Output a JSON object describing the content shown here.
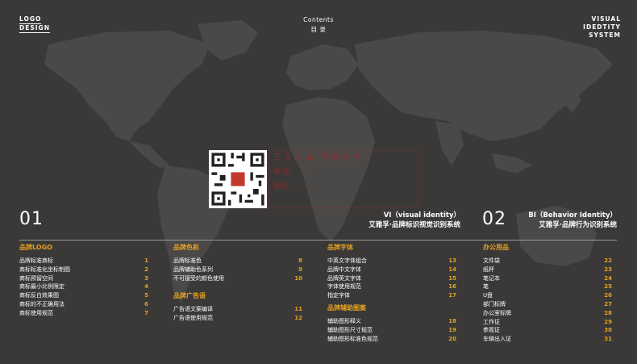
{
  "header": {
    "left_line1": "LOGO",
    "left_line2": "DESIGN",
    "center_en": "Contents",
    "center_cn": "目 录",
    "right_line1": "VISUAL",
    "right_line2": "IDEDTITY",
    "right_line3": "SYSTEM"
  },
  "watermark": {
    "line1": "三 艾 众 品 · 牌 原 商 务 ...",
    "line2": "电话：...",
    "line3": "网址：..."
  },
  "section_vi": {
    "number": "01",
    "title_en": "VI（visual identity）",
    "title_cn": "艾雅孚·品牌标识视觉识别系统"
  },
  "section_bi": {
    "number": "02",
    "title_en": "BI（Behavior Identity）",
    "title_cn": "艾雅孚·品牌行为识别系统"
  },
  "col1": {
    "cat": "品牌LOGO",
    "items": [
      {
        "label": "品牌标准商标",
        "n": "1"
      },
      {
        "label": "商标标准化坐标制图",
        "n": "2"
      },
      {
        "label": "商标预留空间",
        "n": "3"
      },
      {
        "label": "商标最小比例限定",
        "n": "4"
      },
      {
        "label": "商标反白效果图",
        "n": "5"
      },
      {
        "label": "商标的不正确用法",
        "n": "6"
      },
      {
        "label": "商标使用规范",
        "n": "7"
      }
    ]
  },
  "col2": {
    "cat1": "品牌色彩",
    "items1": [
      {
        "label": "品牌标准色",
        "n": "8"
      },
      {
        "label": "品牌辅助色系列",
        "n": "9"
      },
      {
        "label": "不可接受的颜色使用",
        "n": "10"
      }
    ],
    "cat2": "品牌广告语",
    "items2": [
      {
        "label": "广告语文案编译",
        "n": "11"
      },
      {
        "label": "广告语使用规范",
        "n": "12"
      }
    ]
  },
  "col3": {
    "cat1": "品牌字体",
    "items1": [
      {
        "label": "中英文字体组合",
        "n": "13"
      },
      {
        "label": "品牌中文字体",
        "n": "14"
      },
      {
        "label": "品牌英文字体",
        "n": "15"
      },
      {
        "label": "字体使用规范",
        "n": "16"
      },
      {
        "label": "指定字体",
        "n": "17"
      }
    ],
    "cat2": "品牌辅助图案",
    "items2": [
      {
        "label": "辅助图形释义",
        "n": "18"
      },
      {
        "label": "辅助图形尺寸规范",
        "n": "19"
      },
      {
        "label": "辅助图形标准色规范",
        "n": "20"
      }
    ]
  },
  "col4": {
    "cat": "办公用品",
    "items": [
      {
        "label": "文件袋",
        "n": "22"
      },
      {
        "label": "纸杯",
        "n": "23"
      },
      {
        "label": "笔记本",
        "n": "24"
      },
      {
        "label": "笔",
        "n": "25"
      },
      {
        "label": "U盘",
        "n": "26"
      },
      {
        "label": "部门标牌",
        "n": "27"
      },
      {
        "label": "办公室标牌",
        "n": "28"
      },
      {
        "label": "工作证",
        "n": "29"
      },
      {
        "label": "参观证",
        "n": "30"
      },
      {
        "label": "车辆出入证",
        "n": "31"
      }
    ]
  },
  "colors": {
    "background": "#3a3938",
    "map": "#4a4948",
    "accent": "#e5a021",
    "text": "#ffffff"
  }
}
